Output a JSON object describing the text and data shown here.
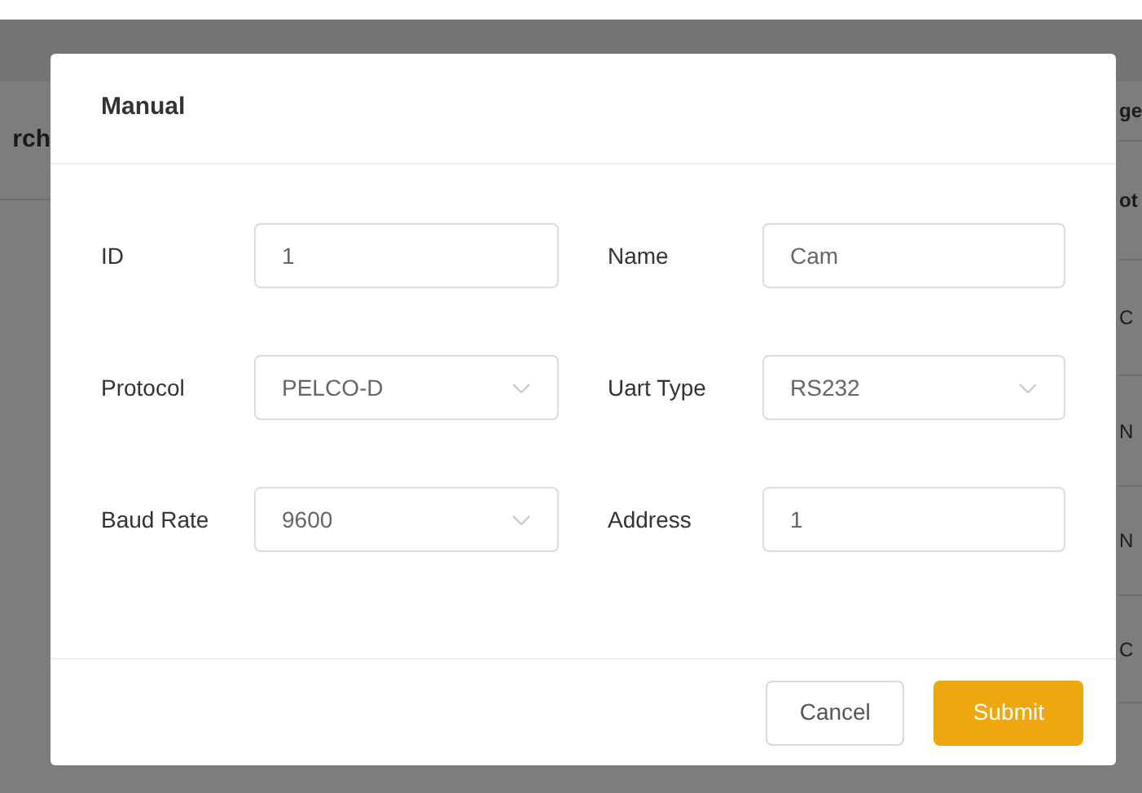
{
  "background": {
    "left_column": [
      {
        "text": "rch",
        "bold": true
      }
    ],
    "right_column": [
      {
        "text": "ge",
        "bold": true
      },
      {
        "text": "ot",
        "bold": true
      },
      {
        "text": "C",
        "bold": false
      },
      {
        "text": "N",
        "bold": false
      },
      {
        "text": "N",
        "bold": false
      },
      {
        "text": "C",
        "bold": false
      }
    ]
  },
  "dialog": {
    "title": "Manual",
    "fields": [
      {
        "label": "ID",
        "kind": "input",
        "value": "1"
      },
      {
        "label": "Name",
        "kind": "input",
        "value": "Cam"
      },
      {
        "label": "Protocol",
        "kind": "select",
        "value": "PELCO-D"
      },
      {
        "label": "Uart Type",
        "kind": "select",
        "value": "RS232"
      },
      {
        "label": "Baud Rate",
        "kind": "select",
        "value": "9600"
      },
      {
        "label": "Address",
        "kind": "input",
        "value": "1"
      }
    ],
    "buttons": [
      {
        "label": "Cancel",
        "kind": "secondary"
      },
      {
        "label": "Submit",
        "kind": "primary"
      }
    ]
  }
}
